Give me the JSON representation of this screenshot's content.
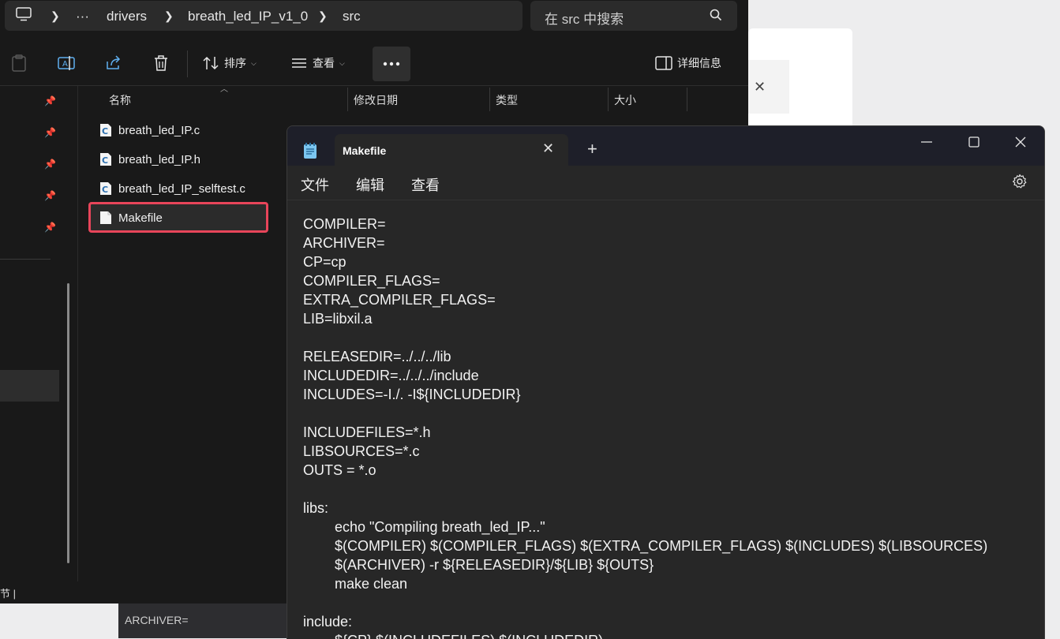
{
  "background": {
    "close_glyph": "✕",
    "behind_editor_ghost": "COMPILER=",
    "behind_editor_line": "ARCHIVER="
  },
  "explorer": {
    "address": [
      "drivers",
      "breath_led_IP_v1_0",
      "src"
    ],
    "ellipsis": "···",
    "search_placeholder": "在 src 中搜索",
    "toolbar": {
      "sort_label": "排序",
      "view_label": "查看",
      "details_label": "详细信息"
    },
    "columns": [
      "名称",
      "修改日期",
      "类型",
      "大小"
    ],
    "files": [
      {
        "name": "breath_led_IP.c",
        "icon": "c-source-file-icon"
      },
      {
        "name": "breath_led_IP.h",
        "icon": "c-source-file-icon"
      },
      {
        "name": "breath_led_IP_selftest.c",
        "icon": "c-source-file-icon"
      },
      {
        "name": "Makefile",
        "icon": "blank-file-icon"
      }
    ],
    "status_text": "节  |",
    "accent_highlight": "#e8455a"
  },
  "notepad": {
    "tab_title": "Makefile",
    "menu": [
      "文件",
      "编辑",
      "查看"
    ],
    "lines": [
      {
        "text": "COMPILER=",
        "indent": false
      },
      {
        "text": "ARCHIVER=",
        "indent": false
      },
      {
        "text": "CP=cp",
        "indent": false
      },
      {
        "text": "COMPILER_FLAGS=",
        "indent": false
      },
      {
        "text": "EXTRA_COMPILER_FLAGS=",
        "indent": false
      },
      {
        "text": "LIB=libxil.a",
        "indent": false
      },
      {
        "text": "",
        "indent": false
      },
      {
        "text": "RELEASEDIR=../../../lib",
        "indent": false
      },
      {
        "text": "INCLUDEDIR=../../../include",
        "indent": false
      },
      {
        "text": "INCLUDES=-I./. -I${INCLUDEDIR}",
        "indent": false
      },
      {
        "text": "",
        "indent": false
      },
      {
        "text": "INCLUDEFILES=*.h",
        "indent": false
      },
      {
        "text": "LIBSOURCES=*.c",
        "indent": false
      },
      {
        "text": "OUTS = *.o",
        "indent": false
      },
      {
        "text": "",
        "indent": false
      },
      {
        "text": "libs:",
        "indent": false
      },
      {
        "text": "echo \"Compiling breath_led_IP...\"",
        "indent": true
      },
      {
        "text": "$(COMPILER) $(COMPILER_FLAGS) $(EXTRA_COMPILER_FLAGS) $(INCLUDES) $(LIBSOURCES)",
        "indent": true
      },
      {
        "text": "$(ARCHIVER) -r ${RELEASEDIR}/${LIB} ${OUTS}",
        "indent": true
      },
      {
        "text": "make clean",
        "indent": true
      },
      {
        "text": "",
        "indent": false
      },
      {
        "text": "include:",
        "indent": false
      },
      {
        "text": "${CP} $(INCLUDEFILES) $(INCLUDEDIR)",
        "indent": true
      }
    ]
  }
}
